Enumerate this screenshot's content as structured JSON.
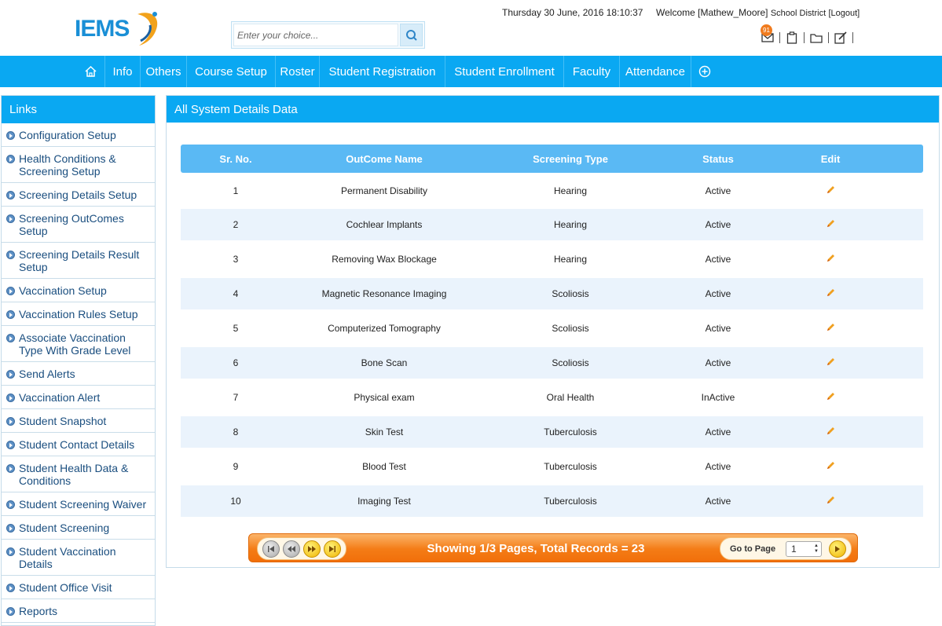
{
  "header": {
    "logo_text": "IEMS",
    "search_placeholder": "Enter your choice...",
    "datetime": "Thursday 30 June, 2016 18:10:37",
    "welcome_prefix": "Welcome [Mathew_Moore]",
    "welcome_district": "School District",
    "logout_label": "[Logout]",
    "mail_badge": "91"
  },
  "nav": {
    "items": [
      {
        "label": "Info"
      },
      {
        "label": "Others"
      },
      {
        "label": "Course Setup"
      },
      {
        "label": "Roster"
      },
      {
        "label": "Student Registration"
      },
      {
        "label": "Student Enrollment"
      },
      {
        "label": "Faculty"
      },
      {
        "label": "Attendance"
      }
    ]
  },
  "sidebar": {
    "title": "Links",
    "items": [
      {
        "label": "Configuration Setup"
      },
      {
        "label": "Health Conditions & Screening Setup"
      },
      {
        "label": "Screening Details Setup"
      },
      {
        "label": "Screening OutComes Setup"
      },
      {
        "label": "Screening Details Result Setup"
      },
      {
        "label": "Vaccination Setup"
      },
      {
        "label": "Vaccination Rules Setup"
      },
      {
        "label": "Associate Vaccination Type With Grade Level"
      },
      {
        "label": "Send Alerts"
      },
      {
        "label": "Vaccination Alert"
      },
      {
        "label": "Student Snapshot"
      },
      {
        "label": "Student Contact Details"
      },
      {
        "label": "Student Health Data & Conditions"
      },
      {
        "label": "Student Screening Waiver"
      },
      {
        "label": "Student Screening"
      },
      {
        "label": "Student Vaccination Details"
      },
      {
        "label": "Student Office Visit"
      },
      {
        "label": "Reports"
      }
    ]
  },
  "panel": {
    "title": "All System Details Data",
    "columns": [
      "Sr. No.",
      "OutCome Name",
      "Screening Type",
      "Status",
      "Edit"
    ],
    "rows": [
      {
        "sr": "1",
        "name": "Permanent Disability",
        "type": "Hearing",
        "status": "Active"
      },
      {
        "sr": "2",
        "name": "Cochlear Implants",
        "type": "Hearing",
        "status": "Active"
      },
      {
        "sr": "3",
        "name": "Removing Wax Blockage",
        "type": "Hearing",
        "status": "Active"
      },
      {
        "sr": "4",
        "name": "Magnetic Resonance Imaging",
        "type": "Scoliosis",
        "status": "Active"
      },
      {
        "sr": "5",
        "name": "Computerized Tomography",
        "type": "Scoliosis",
        "status": "Active"
      },
      {
        "sr": "6",
        "name": "Bone Scan",
        "type": "Scoliosis",
        "status": "Active"
      },
      {
        "sr": "7",
        "name": "Physical exam",
        "type": "Oral Health",
        "status": "InActive"
      },
      {
        "sr": "8",
        "name": "Skin Test",
        "type": "Tuberculosis",
        "status": "Active"
      },
      {
        "sr": "9",
        "name": "Blood Test",
        "type": "Tuberculosis",
        "status": "Active"
      },
      {
        "sr": "10",
        "name": "Imaging Test",
        "type": "Tuberculosis",
        "status": "Active"
      }
    ]
  },
  "pager": {
    "summary": "Showing 1/3  Pages, Total Records = 23",
    "goto_label": "Go to Page",
    "goto_value": "1"
  },
  "colors": {
    "primary": "#0aa8f2",
    "grid_header": "#5ab9f4",
    "row_alt": "#eaf3fc",
    "pager_orange": "#f47c16",
    "link_text": "#1a4e7f"
  },
  "icons": {
    "search": "search-icon",
    "mail": "mail-icon",
    "clipboard": "clipboard-icon",
    "folder": "folder-icon",
    "edit": "edit-note-icon",
    "home": "home-icon",
    "plus": "plus-circle-icon",
    "pencil": "pencil-icon",
    "first": "first-page-icon",
    "prev": "prev-page-icon",
    "next": "next-page-icon",
    "last": "last-page-icon",
    "go": "go-arrow-icon"
  }
}
